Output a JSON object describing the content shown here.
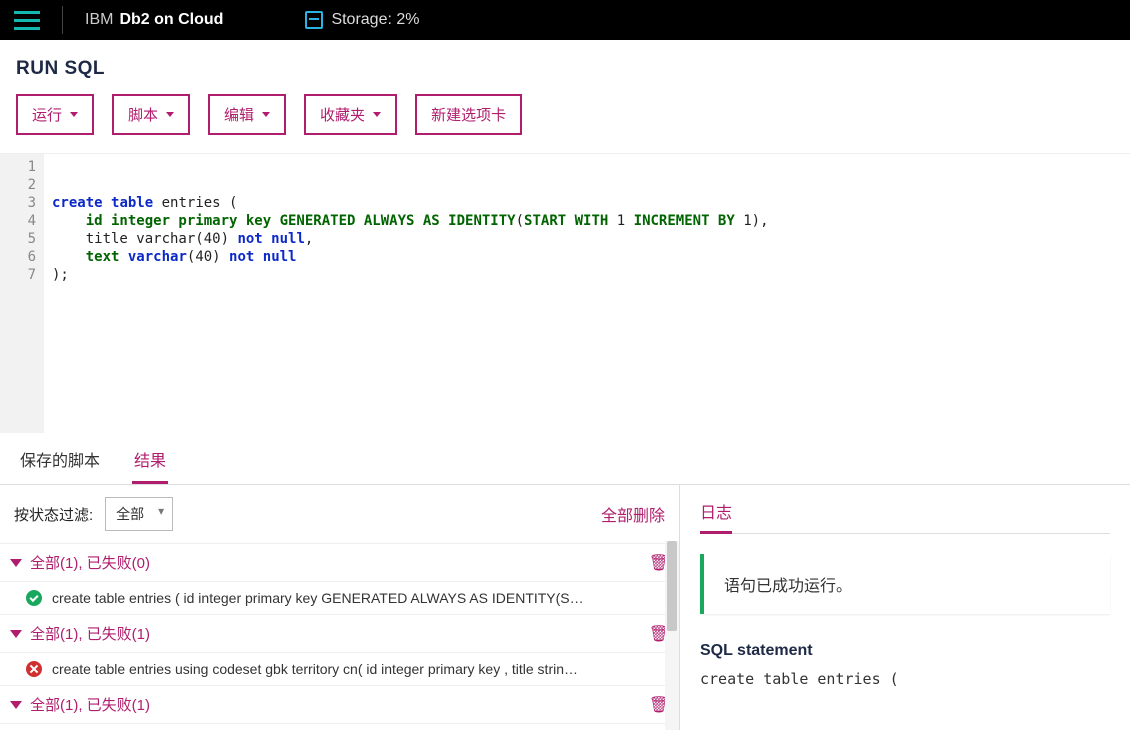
{
  "topbar": {
    "brand_ibm": "IBM",
    "brand_product": "Db2 on Cloud",
    "storage_label": "Storage: 2%"
  },
  "page_title": "RUN SQL",
  "toolbar": {
    "run": "运行",
    "script": "脚本",
    "edit": "编辑",
    "favorites": "收藏夹",
    "new_tab": "新建选项卡"
  },
  "editor": {
    "line_count": 7,
    "code_html": "<span class='plain'>\n\n</span><span class='kw'>create</span> <span class='kw'>table</span> <span class='plain'>entries (</span>\n    <span class='id'>id integer primary key GENERATED ALWAYS AS IDENTITY</span><span class='plain'>(</span><span class='id'>START WITH</span> <span class='plain'>1</span> <span class='id'>INCREMENT BY</span> <span class='plain'>1),</span>\n    <span class='plain'>title varchar(40)</span> <span class='kw'>not null</span><span class='plain'>,</span>\n    <span class='id'>text</span> <span class='kw'>varchar</span><span class='plain'>(40)</span> <span class='kw'>not null</span>\n<span class='plain'>);</span>"
  },
  "tabs": {
    "saved_scripts": "保存的脚本",
    "results": "结果"
  },
  "filter": {
    "label": "按状态过滤:",
    "selected": "全部",
    "delete_all": "全部删除"
  },
  "groups": [
    {
      "header": "全部(1), 已失败(0)",
      "item_status": "ok",
      "item_text": "create table entries ( id integer primary key GENERATED ALWAYS AS IDENTITY(S…"
    },
    {
      "header": "全部(1), 已失败(1)",
      "item_status": "err",
      "item_text": "create table entries using codeset gbk territory cn( id integer primary key , title strin…"
    },
    {
      "header": "全部(1), 已失败(1)"
    }
  ],
  "log": {
    "tab": "日志",
    "success_msg": "语句已成功运行。",
    "stmt_head": "SQL statement",
    "stmt_code": "create table entries ("
  }
}
